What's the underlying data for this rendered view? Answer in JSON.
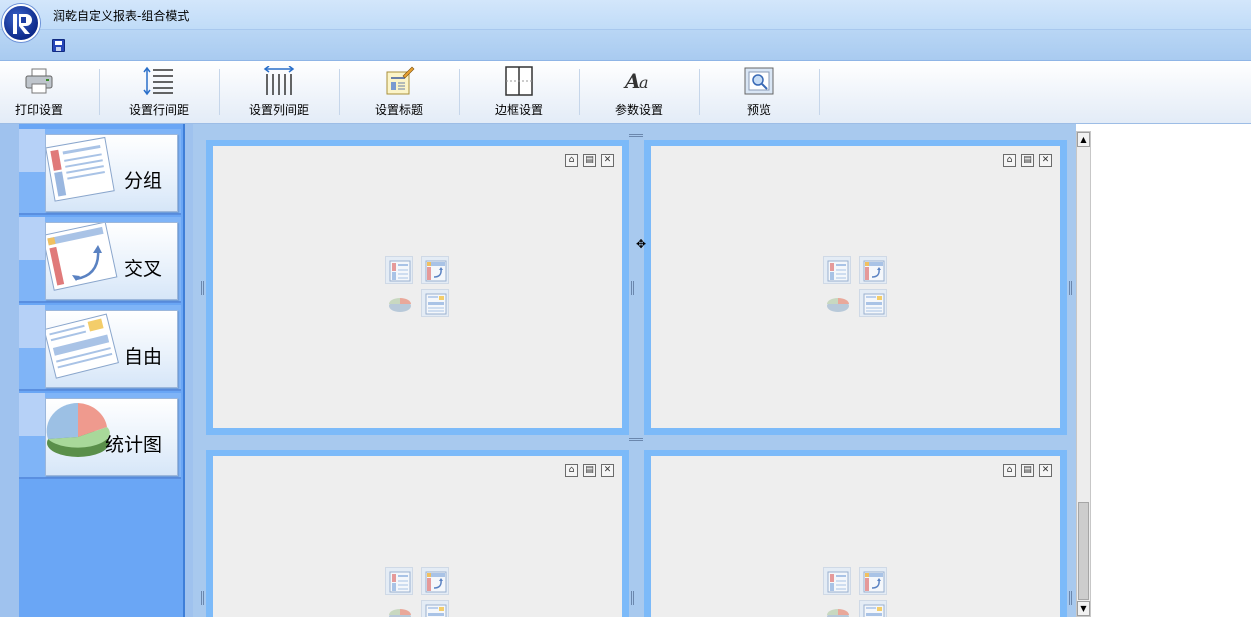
{
  "app": {
    "title": "润乾自定义报表-组合模式"
  },
  "quick_access": {
    "save_icon": "save-icon"
  },
  "toolbar": {
    "items": [
      {
        "label": "打印设置",
        "icon": "printer-icon"
      },
      {
        "label": "设置行间距",
        "icon": "row-spacing-icon"
      },
      {
        "label": "设置列间距",
        "icon": "column-spacing-icon"
      },
      {
        "label": "设置标题",
        "icon": "title-icon"
      },
      {
        "label": "边框设置",
        "icon": "border-icon"
      },
      {
        "label": "参数设置",
        "icon": "font-aa-icon"
      },
      {
        "label": "预览",
        "icon": "preview-icon"
      }
    ]
  },
  "sidebar": {
    "items": [
      {
        "label": "分组",
        "icon": "group-report-icon"
      },
      {
        "label": "交叉",
        "icon": "cross-report-icon"
      },
      {
        "label": "自由",
        "icon": "free-report-icon"
      },
      {
        "label": "统计图",
        "icon": "pie-chart-icon"
      }
    ]
  },
  "panels": [
    {
      "id": "top-left",
      "buttons": [
        "delete-icon",
        "print-icon",
        "close-icon"
      ]
    },
    {
      "id": "top-right",
      "buttons": [
        "delete-icon",
        "print-icon",
        "close-icon"
      ]
    },
    {
      "id": "bottom-left",
      "buttons": [
        "delete-icon",
        "print-icon",
        "close-icon"
      ]
    },
    {
      "id": "bottom-right",
      "buttons": [
        "delete-icon",
        "print-icon",
        "close-icon"
      ]
    }
  ],
  "colors": {
    "accent": "#7cbaf9",
    "sidebar": "#6aa6f5",
    "workarea": "#a8c9ee",
    "titlebar": "#c0dcf8"
  }
}
